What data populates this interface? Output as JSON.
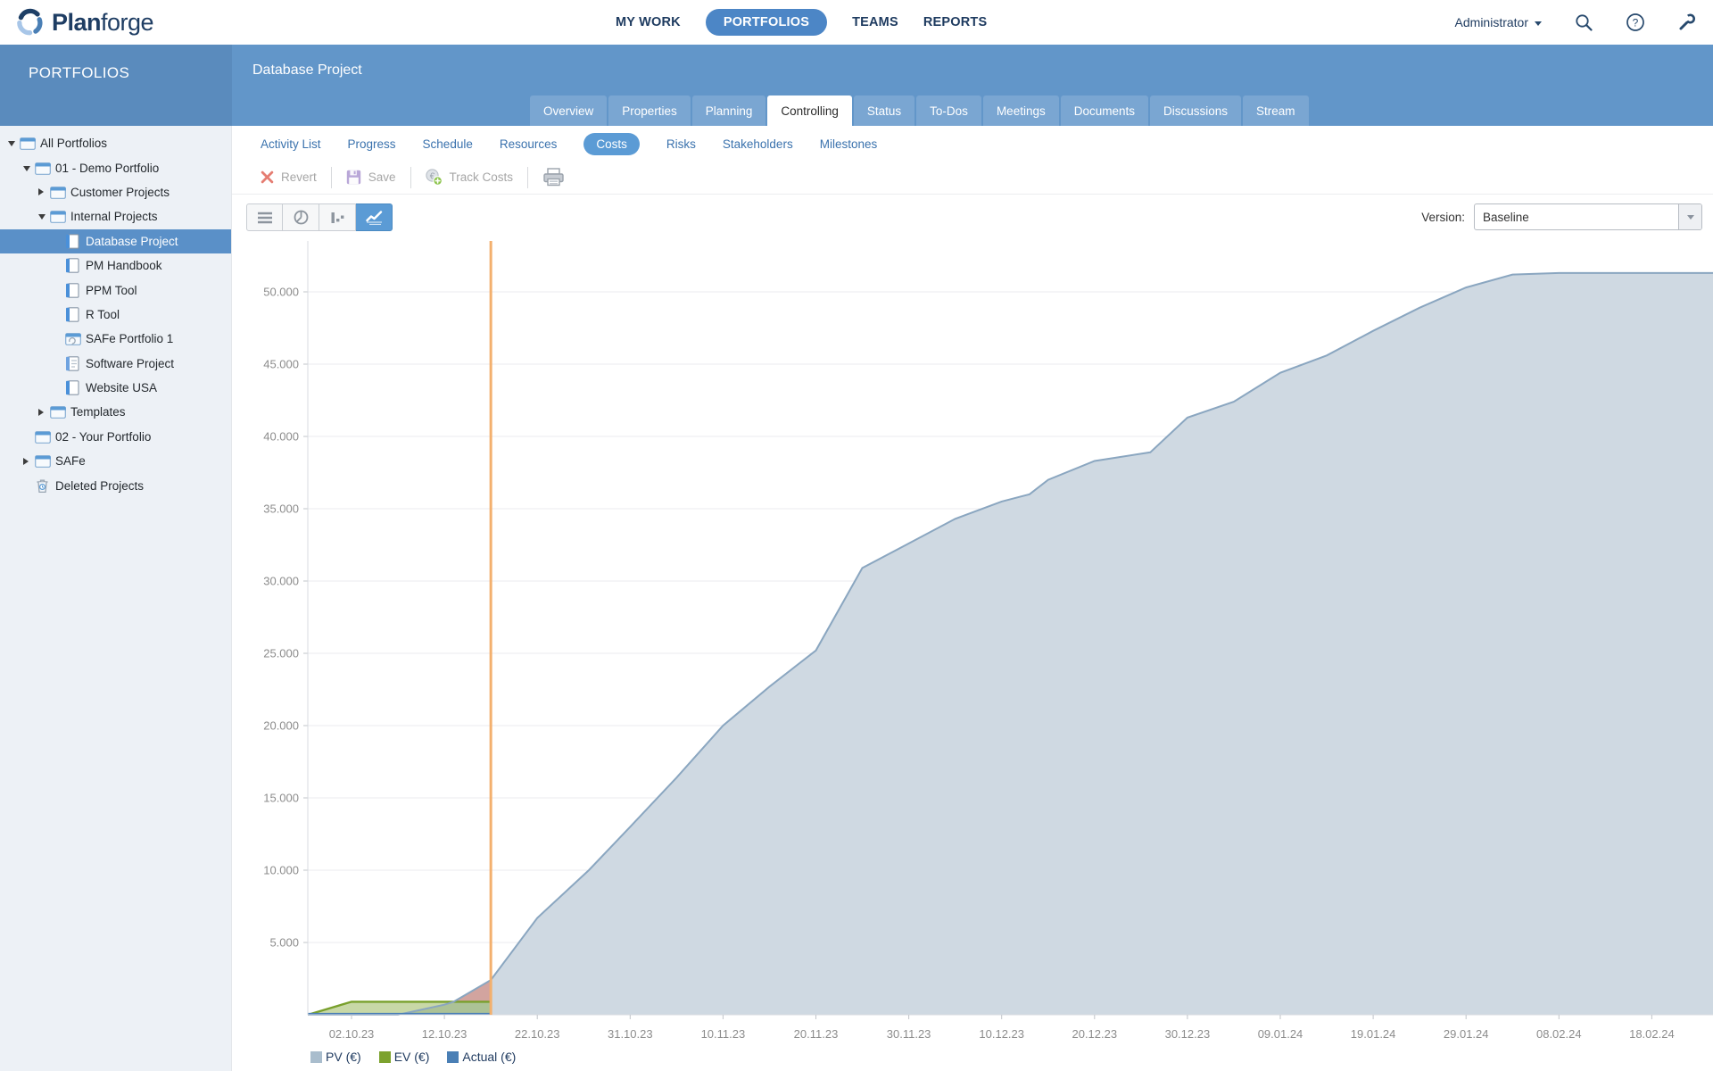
{
  "header": {
    "logo_plan": "Plan",
    "logo_forge": "forge",
    "nav": [
      {
        "label": "MY WORK",
        "active": false
      },
      {
        "label": "PORTFOLIOS",
        "active": true
      },
      {
        "label": "TEAMS",
        "active": false
      },
      {
        "label": "REPORTS",
        "active": false
      }
    ],
    "user_menu": "Administrator",
    "icons": [
      "search-icon",
      "help-icon",
      "wrench-icon"
    ]
  },
  "band": {
    "sidebar_title": "PORTFOLIOS",
    "page_title": "Database Project",
    "tabs": [
      "Overview",
      "Properties",
      "Planning",
      "Controlling",
      "Status",
      "To-Dos",
      "Meetings",
      "Documents",
      "Discussions",
      "Stream"
    ],
    "active_tab": "Controlling"
  },
  "sidebar_tree": [
    {
      "label": "All Portfolios",
      "level": 0,
      "icon": "folder",
      "arrow": "down"
    },
    {
      "label": "01 - Demo Portfolio",
      "level": 1,
      "icon": "folder",
      "arrow": "down"
    },
    {
      "label": "Customer Projects",
      "level": 2,
      "icon": "folder",
      "arrow": "right"
    },
    {
      "label": "Internal Projects",
      "level": 2,
      "icon": "folder",
      "arrow": "down"
    },
    {
      "label": "Database Project",
      "level": 3,
      "icon": "project",
      "arrow": "none",
      "selected": true
    },
    {
      "label": "PM Handbook",
      "level": 3,
      "icon": "project",
      "arrow": "none"
    },
    {
      "label": "PPM Tool",
      "level": 3,
      "icon": "project",
      "arrow": "none"
    },
    {
      "label": "R Tool",
      "level": 3,
      "icon": "project",
      "arrow": "none"
    },
    {
      "label": "SAFe Portfolio 1",
      "level": 3,
      "icon": "safe",
      "arrow": "none"
    },
    {
      "label": "Software Project",
      "level": 3,
      "icon": "software",
      "arrow": "none"
    },
    {
      "label": "Website USA",
      "level": 3,
      "icon": "project",
      "arrow": "none"
    },
    {
      "label": "Templates",
      "level": 2,
      "icon": "folder",
      "arrow": "right"
    },
    {
      "label": "02 - Your Portfolio",
      "level": 1,
      "icon": "folder",
      "arrow": "none"
    },
    {
      "label": "SAFe",
      "level": 1,
      "icon": "folder",
      "arrow": "right"
    },
    {
      "label": "Deleted Projects",
      "level": 1,
      "icon": "trash",
      "arrow": "none"
    }
  ],
  "subtabs": [
    "Activity List",
    "Progress",
    "Schedule",
    "Resources",
    "Costs",
    "Risks",
    "Stakeholders",
    "Milestones"
  ],
  "active_subtab": "Costs",
  "toolbar": {
    "revert_label": "Revert",
    "save_label": "Save",
    "track_costs_label": "Track Costs"
  },
  "chartbar": {
    "version_label": "Version:",
    "version_value": "Baseline"
  },
  "chart_data": {
    "type": "area",
    "x_range": [
      "27.09.23",
      "02.03.24"
    ],
    "ylim": [
      0,
      53500
    ],
    "grid": true,
    "legend_position": "bottom",
    "x_ticks": [
      "02.10.23",
      "12.10.23",
      "22.10.23",
      "31.10.23",
      "10.11.23",
      "20.11.23",
      "30.11.23",
      "10.12.23",
      "20.12.23",
      "30.12.23",
      "09.01.24",
      "19.01.24",
      "29.01.24",
      "08.02.24",
      "18.02.24"
    ],
    "y_tick_values": [
      5000,
      10000,
      15000,
      20000,
      25000,
      30000,
      35000,
      40000,
      45000,
      50000
    ],
    "y_tick_labels": [
      "5.000",
      "10.000",
      "15.000",
      "20.000",
      "25.000",
      "30.000",
      "35.000",
      "40.000",
      "45.000",
      "50.000"
    ],
    "today": "17.10.23",
    "today_color": "#f3b06e",
    "series": [
      {
        "name": "PV (€)",
        "kind": "area",
        "line_color": "#8aa6c0",
        "fill_color": "#cfd9e2",
        "legend_color": "#a9bdcd",
        "points": [
          [
            "27.09.23",
            0
          ],
          [
            "07.10.23",
            0
          ],
          [
            "12.10.23",
            700
          ],
          [
            "13.10.23",
            900
          ],
          [
            "17.10.23",
            2400
          ],
          [
            "22.10.23",
            6700
          ],
          [
            "27.10.23",
            10000
          ],
          [
            "31.10.23",
            13000
          ],
          [
            "05.11.23",
            16400
          ],
          [
            "10.11.23",
            20000
          ],
          [
            "15.11.23",
            22700
          ],
          [
            "20.11.23",
            25200
          ],
          [
            "25.11.23",
            30900
          ],
          [
            "30.11.23",
            32600
          ],
          [
            "05.12.23",
            34300
          ],
          [
            "10.12.23",
            35500
          ],
          [
            "13.12.23",
            36000
          ],
          [
            "15.12.23",
            37000
          ],
          [
            "20.12.23",
            38300
          ],
          [
            "26.12.23",
            38900
          ],
          [
            "30.12.23",
            41300
          ],
          [
            "04.01.24",
            42400
          ],
          [
            "09.01.24",
            44400
          ],
          [
            "14.01.24",
            45600
          ],
          [
            "19.01.24",
            47300
          ],
          [
            "24.01.24",
            48900
          ],
          [
            "29.01.24",
            50300
          ],
          [
            "03.02.24",
            51200
          ],
          [
            "08.02.24",
            51300
          ],
          [
            "02.03.24",
            51300
          ]
        ]
      },
      {
        "name": "EV (€)",
        "kind": "area",
        "line_color": "#79a02c",
        "fill_color": "rgba(124,162,46,0.42)",
        "legend_color": "#7ca22e",
        "points": [
          [
            "27.09.23",
            0
          ],
          [
            "02.10.23",
            900
          ],
          [
            "17.10.23",
            900
          ]
        ]
      },
      {
        "name": "Actual (€)",
        "kind": "line",
        "line_color": "#4a7fb5",
        "legend_color": "#4a7fb5",
        "points": [
          [
            "27.09.23",
            0
          ],
          [
            "17.10.23",
            0
          ]
        ]
      }
    ],
    "variance_region": {
      "from": "13.10.23",
      "to": "17.10.23",
      "base_value": 900,
      "color": "rgba(214,120,103,0.55)"
    }
  }
}
